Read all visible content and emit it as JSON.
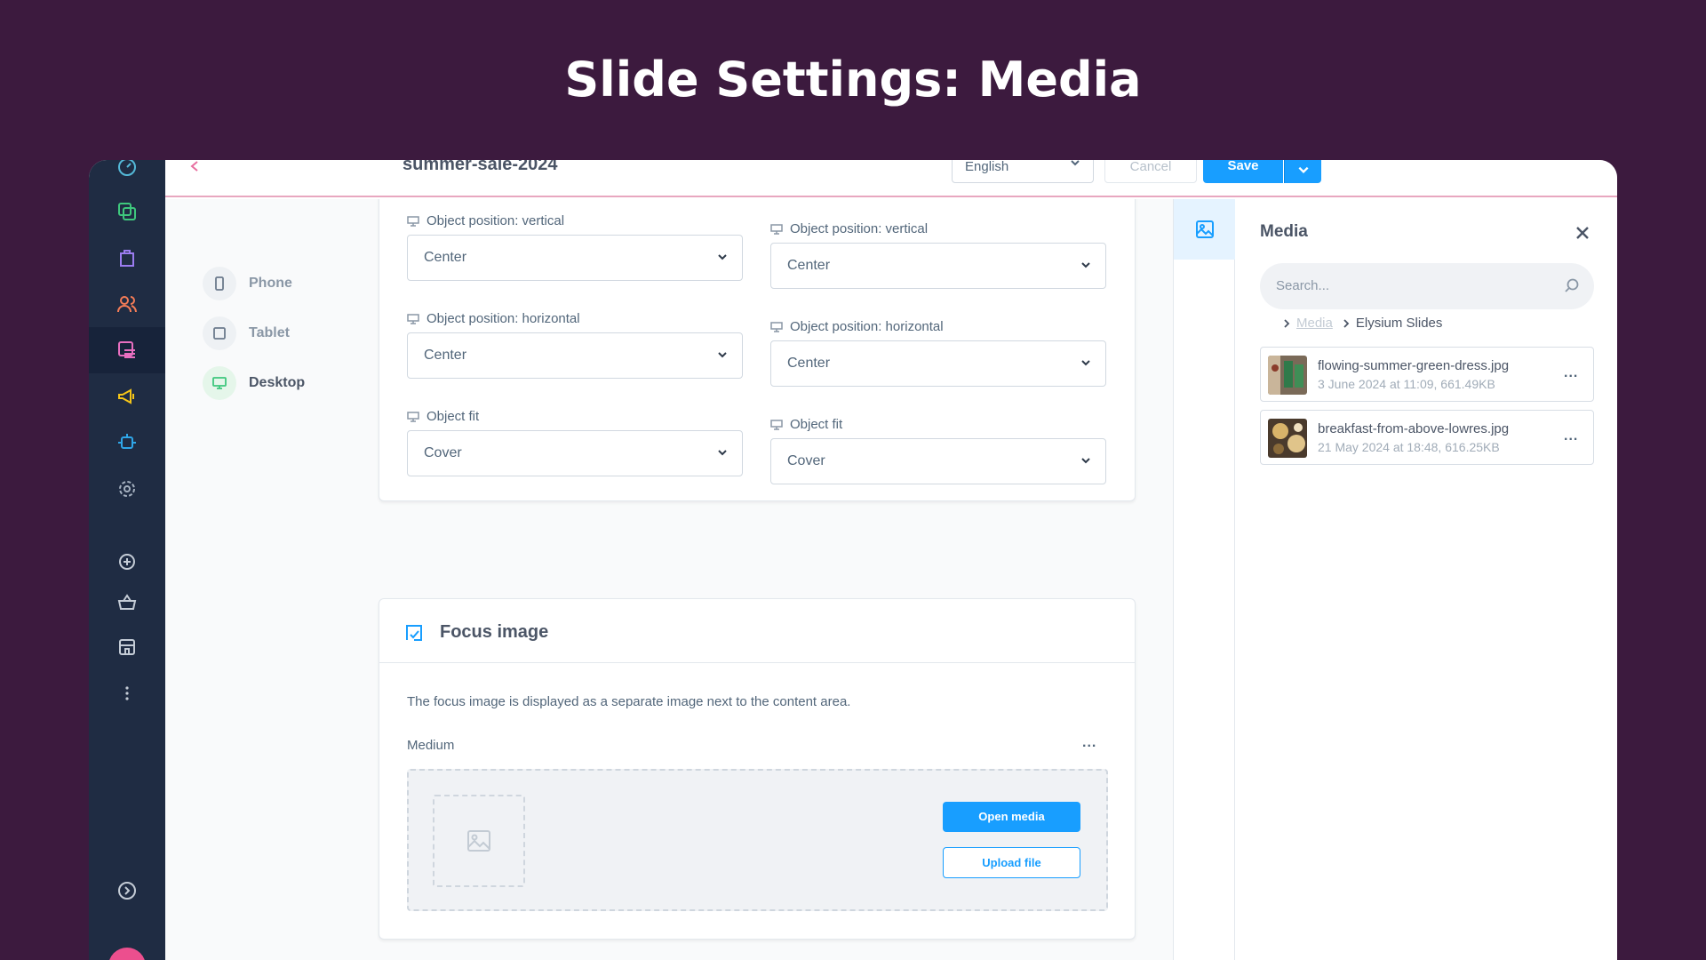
{
  "hero": {
    "title": "Slide Settings: Media"
  },
  "sidebar": {
    "items": [
      {
        "icon": "dashboard-icon",
        "color": "#54b9d8"
      },
      {
        "icon": "catalog-icon",
        "color": "#3ec77d"
      },
      {
        "icon": "orders-icon",
        "color": "#9b7cf0"
      },
      {
        "icon": "customers-icon",
        "color": "#f47c57"
      },
      {
        "icon": "content-icon",
        "color": "#e86fc0"
      },
      {
        "icon": "marketing-icon",
        "color": "#f5c518"
      },
      {
        "icon": "extensions-icon",
        "color": "#2fa6e8"
      },
      {
        "icon": "settings-icon",
        "color": "#a5b1c0"
      },
      {
        "icon": "add-extension-icon",
        "color": "#c4ccd6"
      },
      {
        "icon": "shop-basket-icon",
        "color": "#c4ccd6"
      },
      {
        "icon": "sales-channel-icon",
        "color": "#c4ccd6"
      },
      {
        "icon": "more-icon",
        "color": "#c4ccd6"
      },
      {
        "icon": "collapse-icon",
        "color": "#c4ccd6"
      }
    ]
  },
  "topbar": {
    "record_title": "summer-sale-2024",
    "language": "English",
    "cancel_label": "Cancel",
    "save_label": "Save"
  },
  "devices": [
    {
      "label": "Phone"
    },
    {
      "label": "Tablet"
    },
    {
      "label": "Desktop",
      "active": true
    }
  ],
  "settings": {
    "left": {
      "vertical_label": "Object position: vertical",
      "vertical_value": "Center",
      "horizontal_label": "Object position: horizontal",
      "horizontal_value": "Center",
      "fit_label": "Object fit",
      "fit_value": "Cover"
    },
    "right": {
      "vertical_label": "Object position: vertical",
      "vertical_value": "Center",
      "horizontal_label": "Object position: horizontal",
      "horizontal_value": "Center",
      "fit_label": "Object fit",
      "fit_value": "Cover"
    }
  },
  "focus": {
    "title": "Focus image",
    "description": "The focus image is displayed as a separate image next to the content area.",
    "medium_label": "Medium",
    "more": "...",
    "open_media_label": "Open media",
    "upload_label": "Upload file"
  },
  "media": {
    "title": "Media",
    "search_placeholder": "Search...",
    "breadcrumb_root": "Media",
    "breadcrumb_current": "Elysium Slides",
    "files": [
      {
        "name": "flowing-summer-green-dress.jpg",
        "meta": "3 June 2024 at 11:09, 661.49KB",
        "more": "..."
      },
      {
        "name": "breakfast-from-above-lowres.jpg",
        "meta": "21 May 2024 at 18:48, 616.25KB",
        "more": "..."
      }
    ]
  },
  "colors": {
    "background": "#3c1a3e",
    "sidebar": "#1f2c43",
    "primary": "#189eff",
    "accent_line": "#e8a7c0"
  }
}
